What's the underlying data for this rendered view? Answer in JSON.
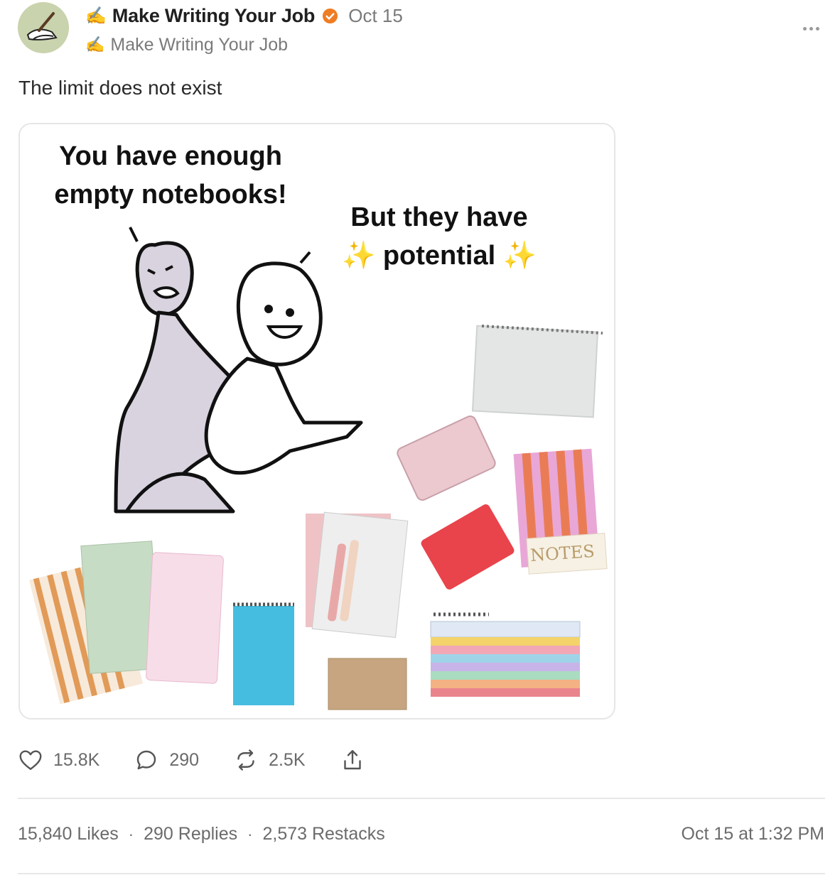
{
  "post": {
    "author_emoji": "✍️",
    "author_name": "Make Writing Your Job",
    "date": "Oct 15",
    "handle_emoji": "✍️",
    "handle": "Make Writing Your Job",
    "text": "The limit does not exist",
    "image": {
      "caption_left": "You have enough empty notebooks!",
      "caption_right_line1": "But they have",
      "caption_right_sparkle": "✨",
      "caption_right_word": "potential",
      "notebook_label": "NOTES"
    }
  },
  "actions": {
    "likes": "15.8K",
    "replies": "290",
    "restacks": "2.5K"
  },
  "stats": {
    "likes": "15,840 Likes",
    "replies": "290 Replies",
    "restacks": "2,573 Restacks",
    "separator": "·",
    "timestamp": "Oct 15 at 1:32 PM"
  },
  "colors": {
    "verified": "#ef7d22",
    "text_muted": "#7a7a7a"
  }
}
